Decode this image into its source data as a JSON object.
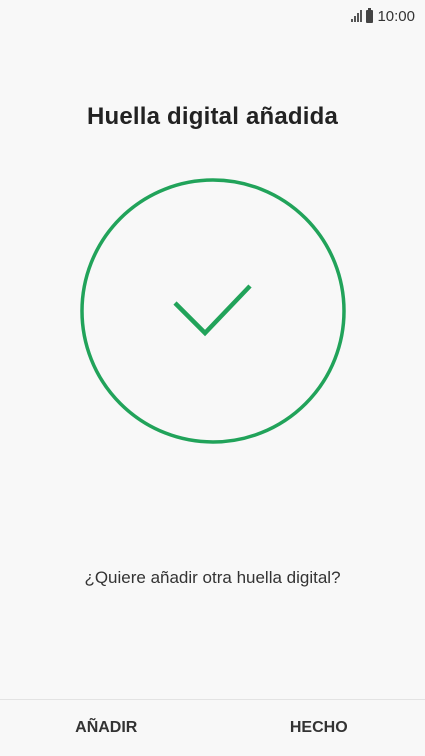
{
  "status_bar": {
    "time": "10:00",
    "icons": [
      "signal-icon",
      "battery-icon"
    ]
  },
  "title": "Huella digital añadida",
  "graphic": {
    "icon": "checkmark-circle-icon",
    "color": "#21a35a"
  },
  "prompt": "¿Quiere añadir otra huella digital?",
  "actions": {
    "add_label": "AÑADIR",
    "done_label": "HECHO"
  }
}
